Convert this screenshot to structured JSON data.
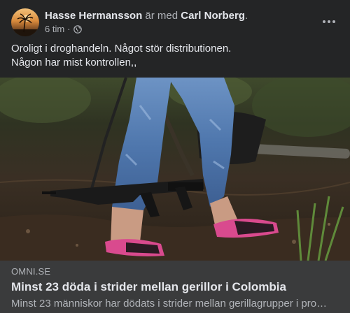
{
  "post": {
    "author_name": "Hasse Hermansson",
    "with_text": " är med ",
    "tagged_name": "Carl Norberg",
    "trailing": ".",
    "timestamp": "6 tim",
    "separator": "·",
    "privacy_icon": "globe-icon",
    "more_icon": "more-options-icon",
    "text_lines": [
      "Oroligt i droghandeln. Något stör distributionen.",
      "Någon har mist kontrollen,,"
    ]
  },
  "link_preview": {
    "domain": "OMNI.SE",
    "title": "Minst 23 döda i strider mellan gerillor i Colombia",
    "description": "Minst 23 människor har dödats i strider mellan gerillagrupper i pro…"
  },
  "colors": {
    "card_background": "#242526",
    "preview_background": "#3a3b3c",
    "primary_text": "#e4e6eb",
    "secondary_text": "#b0b3b8"
  }
}
